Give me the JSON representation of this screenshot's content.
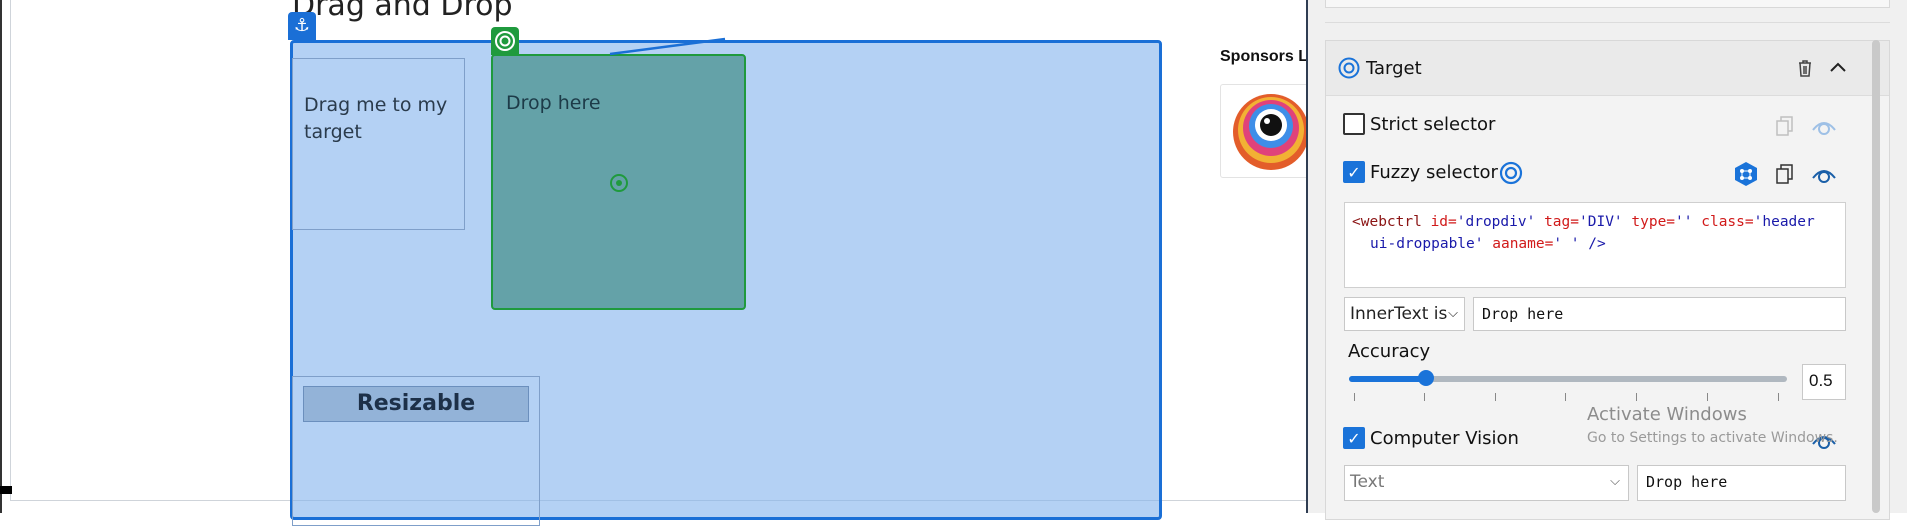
{
  "page": {
    "title": "Drag and Drop",
    "drag_text": "Drag me to my target",
    "drop_text": "Drop here",
    "resizable_label": "Resizable",
    "sponsors_label": "Sponsors Li"
  },
  "panel": {
    "section_title": "Target",
    "strict_selector_label": "Strict selector",
    "strict_selector_checked": false,
    "fuzzy_selector_label": "Fuzzy selector",
    "fuzzy_selector_checked": true,
    "selector_code": {
      "open": "<webctrl",
      "a1": " id=",
      "v1": "'dropdiv'",
      "a2": " tag=",
      "v2": "'DIV'",
      "a3": " type=",
      "v3": "''",
      "a4": " class=",
      "v4": "'header",
      "v4b": "ui-droppable'",
      "a5": " aaname=",
      "v5": "'  '",
      "close": " />"
    },
    "innertext_select": "InnerText is",
    "innertext_value": "Drop here",
    "accuracy_label": "Accuracy",
    "accuracy_value": "0.5",
    "computer_vision_label": "Computer Vision",
    "computer_vision_checked": true,
    "cv_type_select": "Text",
    "cv_value": "Drop here"
  },
  "watermark": {
    "line1": "Activate Windows",
    "line2": "Go to Settings to activate Windows."
  },
  "colors": {
    "highlight_blue": "#1a6fd6",
    "target_green": "#1f9a3d",
    "accent": "#1a73d9"
  },
  "icons": [
    "anchor-icon",
    "target-icon",
    "delete-icon",
    "chevron-up-icon",
    "copy-icon",
    "eye-icon",
    "network-icon"
  ]
}
